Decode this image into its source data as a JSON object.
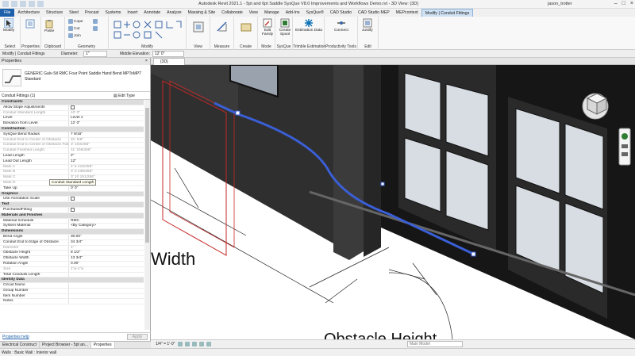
{
  "app": {
    "title": "Autodesk Revit 2021.1 - 5pt and 6pt Saddle SysQue V8.0 Improvements and Workflows Demo.rvt - 3D View: {3D}",
    "user": "jason_trotter"
  },
  "ribbon_tabs": [
    "File",
    "Architecture",
    "Structure",
    "Steel",
    "Precast",
    "Systems",
    "Insert",
    "Annotate",
    "Analyze",
    "Massing & Site",
    "Collaborate",
    "View",
    "Manage",
    "Add-Ins",
    "SysQue®",
    "CAD Studio",
    "CAD Studio MEP",
    "MEPcontext",
    "Modify | Conduit Fittings"
  ],
  "active_tab": "Modify | Conduit Fittings",
  "ribbon": {
    "modify": "Modify",
    "paste": "Paste",
    "cope": "Cope",
    "cut": "Cut",
    "join": "Join",
    "groups": {
      "select": "Select",
      "properties": "Properties",
      "clipboard": "Clipboard",
      "geometry": "Geometry",
      "modify": "Modify",
      "view": "View",
      "measure": "Measure",
      "create": "Create",
      "mode": "Mode",
      "sysque": "SysQue",
      "trimble": "Trimble Estimation",
      "productivity": "Productivity Tools",
      "edit": "Edit"
    },
    "buttons": {
      "edit_family": "Edit Family",
      "create_spool": "Create Spool",
      "estimation_data": "Estimation Data",
      "connect": "Connect",
      "justify": "Justify"
    }
  },
  "options_bar": {
    "context": "Modify | Conduit Fittings",
    "diameter_label": "Diameter:",
    "diameter_value": "1\"",
    "elevation_label": "Middle Elevation:",
    "elevation_value": "12' 0\""
  },
  "properties": {
    "header": "Properties",
    "type_name": "GENERIC Galv-Stl RMC Four Point Saddle Hand Bend MPToMPT Standard",
    "selection": "Conduit Fittings (1)",
    "edit_type": "Edit Type",
    "tooltip": "Conduit Standard Length",
    "help": "Properties help",
    "apply": "Apply",
    "rows": [
      {
        "group": true,
        "name": "Constraints"
      },
      {
        "name": "Allow Slope Adjustments",
        "checkbox": true,
        "value": ""
      },
      {
        "name": "Conduit Standard Length",
        "value": "10' 0\"",
        "ro": true
      },
      {
        "name": "Level",
        "value": "Level 1"
      },
      {
        "name": "Elevation from Level",
        "value": "12' 0\""
      },
      {
        "group": true,
        "name": "Construction"
      },
      {
        "name": "SysQue Bend Radius",
        "value": "7 9/16\""
      },
      {
        "name": "Conduit End to Center of Obstacle",
        "value": "31' 5/8\"",
        "ro": true
      },
      {
        "name": "Conduit End to Center of Obstacle Flat",
        "value": "3' 103/256\"",
        "ro": true
      },
      {
        "name": "Conduit Finished Length",
        "value": "11' 209/256\"",
        "ro": true
      },
      {
        "name": "Lead Length",
        "value": "2\""
      },
      {
        "name": "Lead Out Length",
        "value": "12\""
      },
      {
        "name": "Mark A",
        "value": "4' 6 215/256\"",
        "ro": true
      },
      {
        "name": "Mark B",
        "value": "3' 3 239/256\"",
        "ro": true
      },
      {
        "name": "Mark C",
        "value": "3' 10 151/256\"",
        "ro": true
      },
      {
        "name": "Mark D",
        "value": "7' 3 1/2\"",
        "ro": true
      },
      {
        "name": "Take Up",
        "value": "0' 0\""
      },
      {
        "group": true,
        "name": "Graphics"
      },
      {
        "name": "Use Annotation Scale",
        "checkbox": true,
        "value": ""
      },
      {
        "group": true,
        "name": "Text"
      },
      {
        "name": "PurchasedFitting",
        "checkbox": true,
        "value": ""
      },
      {
        "group": true,
        "name": "Materials and Finishes"
      },
      {
        "name": "Material Schedule",
        "value": "RMC"
      },
      {
        "name": "System Material",
        "value": "<By Category>"
      },
      {
        "group": true,
        "name": "Dimensions"
      },
      {
        "name": "Bend Angle",
        "value": "30.00°"
      },
      {
        "name": "Conduit End to Edge of Obstacle",
        "value": "34 3/4\""
      },
      {
        "name": "Diameter",
        "value": "1\"",
        "ro": true
      },
      {
        "name": "Obstacle Height",
        "value": "8 1/2\""
      },
      {
        "name": "Obstacle Width",
        "value": "13 3/4\""
      },
      {
        "name": "Rotation Angle",
        "value": "0.00°"
      },
      {
        "name": "Size",
        "value": "1\"ø-1\"ø",
        "ro": true
      },
      {
        "name": "Total Conduits Length",
        "value": ""
      },
      {
        "group": true,
        "name": "Identity Data"
      },
      {
        "name": "Circuit Name",
        "value": ""
      },
      {
        "name": "Group Number",
        "value": ""
      },
      {
        "name": "Item Number",
        "value": ""
      },
      {
        "name": "Notes",
        "value": ""
      }
    ]
  },
  "palette_tabs": [
    "Electrical Construct",
    "Project Browser - 5pt an...",
    "Properties"
  ],
  "view": {
    "tab": "{3D}",
    "label_width": "Width",
    "label_obstacle": "Obstacle Height",
    "scale": "1/4\" = 1'-0\"",
    "model": "Main Model"
  },
  "status": "Walls : Basic Wall : Interior wall",
  "colors": {
    "accent": "#1c5faa",
    "conduit": "#3a5fd6",
    "wall": "#2b2b2b"
  }
}
